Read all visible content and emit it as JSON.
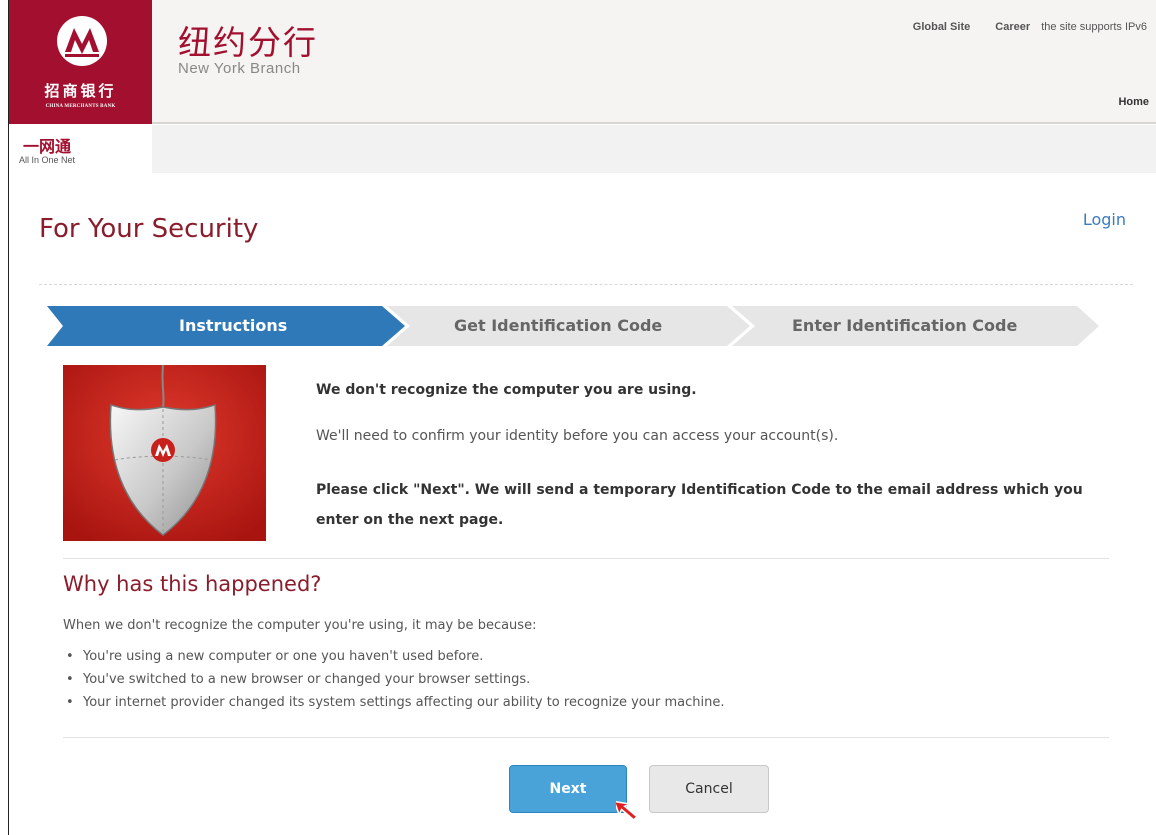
{
  "header": {
    "bank_name_cn": "招商银行",
    "bank_name_en": "CHINA MERCHANTS BANK",
    "branch_cn": "纽约分行",
    "branch_en": "New York Branch",
    "top_links": [
      "Global Site",
      "Career",
      "the site supports IPv6"
    ],
    "home_label": "Home",
    "aio_cn": "一网通",
    "aio_en": "All In One Net"
  },
  "page": {
    "title": "For Your Security",
    "login_label": "Login"
  },
  "steps": [
    {
      "label": "Instructions",
      "active": true
    },
    {
      "label": "Get Identification Code",
      "active": false
    },
    {
      "label": "Enter Identification Code",
      "active": false
    }
  ],
  "content": {
    "msg_bold": "We don't recognize the computer you are using.",
    "msg_normal": "We'll need to confirm your identity before you can access your account(s).",
    "msg_instruction": "Please click \"Next\". We will send a temporary Identification Code to the email address which you enter on the next page."
  },
  "why": {
    "title": "Why has this happened?",
    "intro": "When we don't recognize the computer you're using, it may be because:",
    "items": [
      "You're using a new computer or one you haven't used before.",
      "You've switched to a new browser or changed your browser settings.",
      "Your internet provider changed its system settings affecting our ability to recognize your machine."
    ]
  },
  "buttons": {
    "next_label": "Next",
    "cancel_label": "Cancel"
  },
  "colors": {
    "brand_red": "#a3102f",
    "step_active": "#2f79b9",
    "step_inactive": "#e6e6e6",
    "next_button": "#4aa3d8"
  },
  "icons": {
    "logo": "cmb-logo-icon",
    "shield": "security-shield-icon",
    "cursor": "mouse-cursor-icon"
  }
}
